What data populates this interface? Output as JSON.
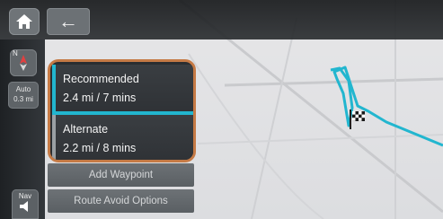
{
  "header": {
    "home_icon": "home-icon",
    "back_icon": "arrow-left-icon",
    "back_glyph": "←"
  },
  "map_controls": {
    "compass_icon": "compass-icon",
    "compass_letter": "N",
    "scale_mode": "Auto",
    "scale_value": "0.3 mi",
    "nav_label": "Nav",
    "nav_icon": "speaker-icon"
  },
  "routes": [
    {
      "name": "Recommended",
      "detail": "2.4 mi / 7 mins",
      "selected": true,
      "color": "#22b6cf"
    },
    {
      "name": "Alternate",
      "detail": "2.2 mi / 8 mins",
      "selected": false,
      "color": "#9aa0a4"
    }
  ],
  "actions": {
    "add_waypoint": "Add Waypoint",
    "route_avoid": "Route Avoid Options"
  },
  "colors": {
    "route_highlight": "#22b6cf",
    "panel_outline": "#c57a45",
    "destination_flag": "checkered-flag-icon"
  }
}
